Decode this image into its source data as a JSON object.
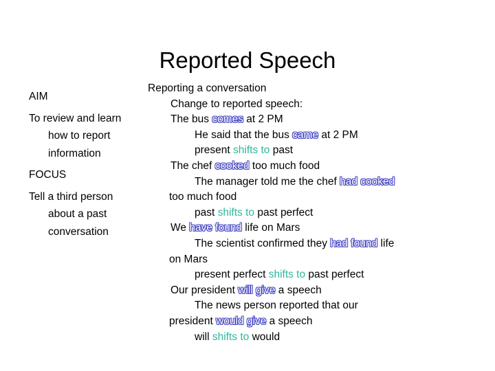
{
  "slide": {
    "title": "Reported Speech",
    "background_color": "#ffffff",
    "text_color": "#000000",
    "accent_blue": "#4a4ac4",
    "accent_teal": "#2eb79b"
  },
  "left_column": {
    "blocks": [
      {
        "id": "aim-heading",
        "text": "AIM"
      },
      {
        "id": "aim-body",
        "text": "To review and learn how to report information"
      },
      {
        "id": "focus-heading",
        "text": "FOCUS"
      },
      {
        "id": "focus-body",
        "text": "Tell a third person about a past conversation"
      }
    ]
  },
  "right_column": {
    "lines": [
      {
        "id": "l1",
        "indent": "ind0",
        "parts": [
          {
            "t": "Reporting a conversation",
            "s": "plain"
          }
        ]
      },
      {
        "id": "l2",
        "indent": "ind1",
        "parts": [
          {
            "t": "Change to reported speech:",
            "s": "plain"
          }
        ]
      },
      {
        "id": "l3",
        "indent": "ind1",
        "parts": [
          {
            "t": "The bus ",
            "s": "plain"
          },
          {
            "t": "comes",
            "s": "verb-blue"
          },
          {
            "t": " at 2 PM",
            "s": "plain"
          }
        ]
      },
      {
        "id": "l4",
        "indent": "ind2",
        "parts": [
          {
            "t": "He said that the bus ",
            "s": "plain"
          },
          {
            "t": "came",
            "s": "verb-blue"
          },
          {
            "t": " at 2 PM",
            "s": "plain"
          }
        ]
      },
      {
        "id": "l5",
        "indent": "ind2",
        "parts": [
          {
            "t": "present ",
            "s": "plain"
          },
          {
            "t": "shifts to",
            "s": "shift-teal"
          },
          {
            "t": " past",
            "s": "plain"
          }
        ]
      },
      {
        "id": "l6",
        "indent": "ind1",
        "parts": [
          {
            "t": "The chef ",
            "s": "plain"
          },
          {
            "t": "cooked",
            "s": "verb-blue"
          },
          {
            "t": " too much food",
            "s": "plain"
          }
        ]
      },
      {
        "id": "l7",
        "indent": "ind2",
        "parts": [
          {
            "t": "The manager told me the chef ",
            "s": "plain"
          },
          {
            "t": "had cooked",
            "s": "verb-blue"
          }
        ]
      },
      {
        "id": "l8",
        "indent": "wrap",
        "parts": [
          {
            "t": "too much food",
            "s": "plain"
          }
        ]
      },
      {
        "id": "l9",
        "indent": "ind2",
        "parts": [
          {
            "t": "past ",
            "s": "plain"
          },
          {
            "t": "shifts to",
            "s": "shift-teal"
          },
          {
            "t": " past perfect",
            "s": "plain"
          }
        ]
      },
      {
        "id": "l10",
        "indent": "ind1",
        "parts": [
          {
            "t": "We ",
            "s": "plain"
          },
          {
            "t": "have found",
            "s": "verb-blue"
          },
          {
            "t": " life on Mars",
            "s": "plain"
          }
        ]
      },
      {
        "id": "l11",
        "indent": "ind2",
        "parts": [
          {
            "t": "The scientist confirmed they ",
            "s": "plain"
          },
          {
            "t": "had found",
            "s": "verb-blue"
          },
          {
            "t": " life",
            "s": "plain"
          }
        ]
      },
      {
        "id": "l12",
        "indent": "wrap",
        "parts": [
          {
            "t": "on Mars",
            "s": "plain"
          }
        ]
      },
      {
        "id": "l13",
        "indent": "ind2",
        "parts": [
          {
            "t": "present perfect ",
            "s": "plain"
          },
          {
            "t": "shifts to",
            "s": "shift-teal"
          },
          {
            "t": " past perfect",
            "s": "plain"
          }
        ]
      },
      {
        "id": "l14",
        "indent": "ind1",
        "parts": [
          {
            "t": "Our president ",
            "s": "plain"
          },
          {
            "t": "will give",
            "s": "verb-blue"
          },
          {
            "t": " a speech",
            "s": "plain"
          }
        ]
      },
      {
        "id": "l15",
        "indent": "ind2",
        "parts": [
          {
            "t": "The news person reported that our",
            "s": "plain"
          }
        ]
      },
      {
        "id": "l16",
        "indent": "wrap",
        "parts": [
          {
            "t": "president ",
            "s": "plain"
          },
          {
            "t": "would give",
            "s": "verb-blue"
          },
          {
            "t": " a speech",
            "s": "plain"
          }
        ]
      },
      {
        "id": "l17",
        "indent": "ind2",
        "parts": [
          {
            "t": "will ",
            "s": "plain"
          },
          {
            "t": "shifts to",
            "s": "shift-teal"
          },
          {
            "t": " would",
            "s": "plain"
          }
        ]
      }
    ]
  }
}
